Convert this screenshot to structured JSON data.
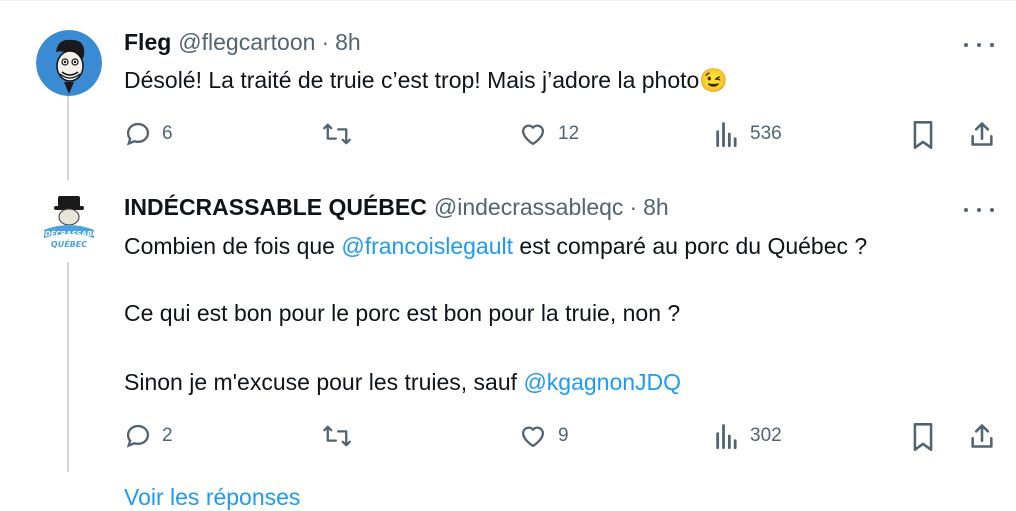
{
  "tweets": [
    {
      "name": "Fleg",
      "handle": "@flegcartoon",
      "separator": "·",
      "time": "8h",
      "text": "Désolé! La traité de truie c’est trop! Mais j’adore la photo",
      "emoji": "😉",
      "replies": "6",
      "likes": "12",
      "views": "536"
    },
    {
      "name": "INDÉCRASSABLE QUÉBEC",
      "handle": "@indecrassableqc",
      "separator": "·",
      "time": "8h",
      "avatar_text": "INDÉCRASSABLE QUÉBEC",
      "line1_before": "Combien de fois que ",
      "line1_mention": "@francoislegault",
      "line1_after": " est comparé au porc du Québec ?",
      "line2": "Ce qui est bon pour le porc est bon pour la truie, non ?",
      "line3_before": "Sinon je m'excuse pour les truies, sauf ",
      "line3_mention": "@kgagnonJDQ",
      "replies": "2",
      "likes": "9",
      "views": "302"
    }
  ],
  "footer_partial": "Voir les réponses",
  "colors": {
    "text": "#0f1419",
    "muted": "#536471",
    "link": "#1d9bf0",
    "thread": "#cfd9de"
  },
  "icons": [
    "reply-icon",
    "retweet-icon",
    "like-icon",
    "views-icon",
    "bookmark-icon",
    "share-icon",
    "more-icon"
  ]
}
